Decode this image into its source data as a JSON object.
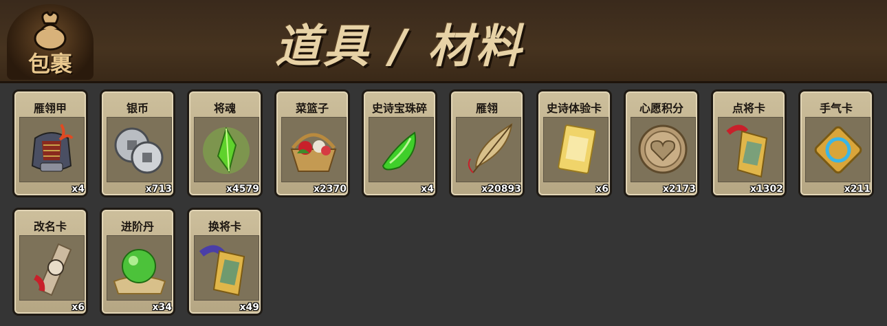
{
  "header": {
    "bag_label": "包裹",
    "title": "道具 / 材料"
  },
  "items": [
    {
      "name": "雁翎甲",
      "count": "x4",
      "icon": "armor-icon"
    },
    {
      "name": "银币",
      "count": "x713",
      "icon": "silver-coin-icon"
    },
    {
      "name": "将魂",
      "count": "x4579",
      "icon": "soul-crystal-icon"
    },
    {
      "name": "菜篮子",
      "count": "x2370",
      "icon": "flower-basket-icon"
    },
    {
      "name": "史诗宝珠碎",
      "count": "x4",
      "icon": "gem-shard-icon"
    },
    {
      "name": "雁翎",
      "count": "x20893",
      "icon": "feather-icon"
    },
    {
      "name": "史诗体验卡",
      "count": "x6",
      "icon": "gold-card-icon"
    },
    {
      "name": "心愿积分",
      "count": "x2173",
      "icon": "heart-coin-icon"
    },
    {
      "name": "点将卡",
      "count": "x1302",
      "icon": "general-token-icon"
    },
    {
      "name": "手气卡",
      "count": "x211",
      "icon": "luck-card-icon"
    },
    {
      "name": "改名卡",
      "count": "x6",
      "icon": "rename-scroll-icon"
    },
    {
      "name": "进阶丹",
      "count": "x34",
      "icon": "jade-orb-icon"
    },
    {
      "name": "换将卡",
      "count": "x49",
      "icon": "swap-token-icon"
    }
  ]
}
